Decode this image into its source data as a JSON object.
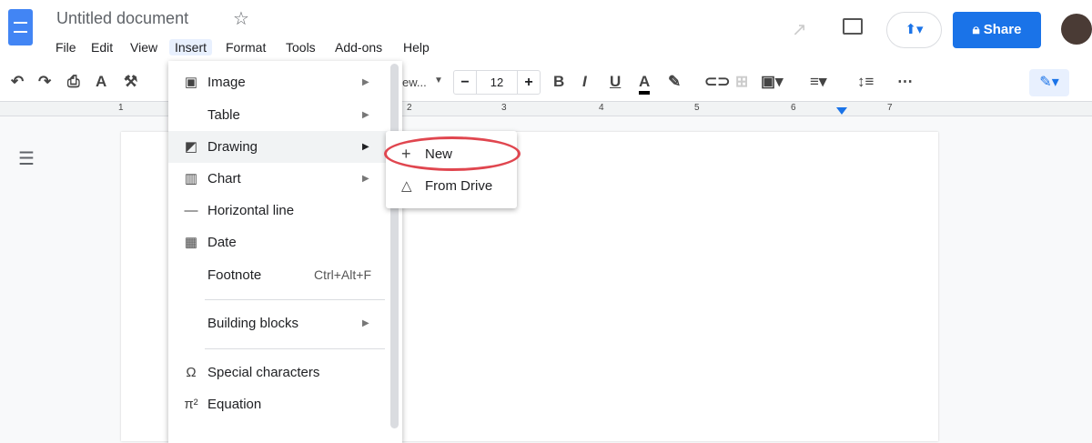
{
  "header": {
    "title": "Untitled document",
    "share_label": "Share",
    "menus": [
      "File",
      "Edit",
      "View",
      "Insert",
      "Format",
      "Tools",
      "Add-ons",
      "Help"
    ]
  },
  "toolbar": {
    "font_partial": "ew...",
    "font_size": "12",
    "text_color": "#000000"
  },
  "ruler": {
    "numbers": [
      "1",
      "2",
      "3",
      "4",
      "5",
      "6",
      "7"
    ]
  },
  "insert_menu": {
    "items": [
      {
        "label": "Image",
        "icon": "image-icon",
        "submenu": true
      },
      {
        "label": "Table",
        "submenu": true
      },
      {
        "label": "Drawing",
        "icon": "drawing-icon",
        "submenu": true,
        "highlighted": true
      },
      {
        "label": "Chart",
        "icon": "chart-icon",
        "submenu": true
      },
      {
        "label": "Horizontal line",
        "icon": "horizontal-line-icon"
      },
      {
        "label": "Date",
        "icon": "calendar-icon"
      },
      {
        "label": "Footnote",
        "shortcut": "Ctrl+Alt+F"
      },
      {
        "label": "Building blocks",
        "submenu": true
      },
      {
        "label": "Special characters",
        "icon": "omega-icon"
      },
      {
        "label": "Equation",
        "icon": "pi-icon"
      }
    ]
  },
  "drawing_submenu": {
    "items": [
      {
        "label": "New",
        "icon": "plus-icon"
      },
      {
        "label": "From Drive",
        "icon": "drive-icon"
      }
    ]
  },
  "colors": {
    "accent": "#1a73e8",
    "highlight_ellipse": "#e0464f"
  }
}
